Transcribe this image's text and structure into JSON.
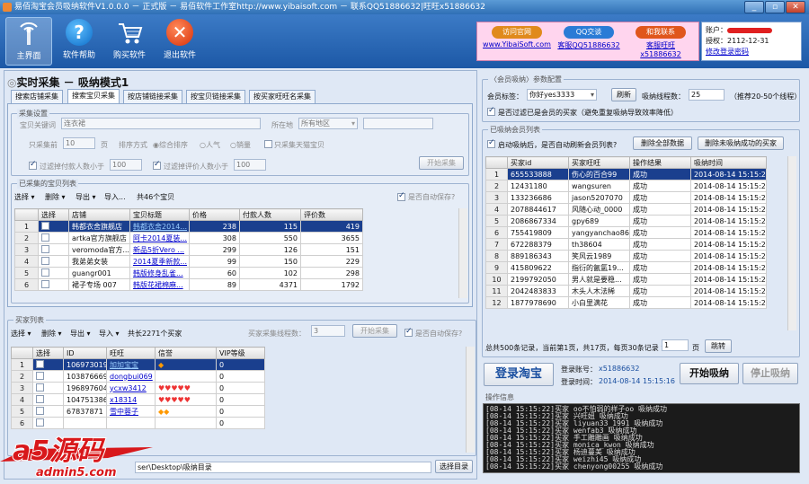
{
  "title": "易佰淘宝会员吸纳软件V1.0.0.0 － 正式版 － 易佰软件工作室http://www.yibaisoft.com － 联系QQ51886632|旺旺x51886632",
  "window_buttons": [
    "_",
    "▫",
    "✕"
  ],
  "toolbar": [
    {
      "label": "主界面"
    },
    {
      "label": "软件帮助"
    },
    {
      "label": "购买软件"
    },
    {
      "label": "退出软件"
    }
  ],
  "ads": [
    {
      "brand": "访问官网",
      "link": "www.YibaiSoft.com",
      "color": "#e08a1c"
    },
    {
      "brand": "QQ交谈",
      "link": "客服QQ51886632",
      "color": "#2a7bd6"
    },
    {
      "brand": "和我联系",
      "link": "客服旺旺x51886632",
      "color": "#e0561c"
    }
  ],
  "account": {
    "label": "账户：",
    "name": "",
    "expiry_label": "授权：",
    "expiry": "2112-12-31",
    "change_pwd": "修改登录密码"
  },
  "mode_title": "实时采集 － 吸纳模式1",
  "tabs": [
    "搜索店铺采集",
    "搜索宝贝采集",
    "按店铺链接采集",
    "按宝贝链接采集",
    "按买家旺旺名采集"
  ],
  "collect_settings": {
    "legend": "采集设置",
    "keyword_label": "宝贝关键词",
    "keyword": "连衣裙",
    "location_label": "所在地",
    "location": "所有地区",
    "pages_label": "只采集前",
    "pages": "10",
    "pages_unit": "页",
    "sort_label": "排序方式",
    "sort_options": [
      "综合排序",
      "人气",
      "销量"
    ],
    "tmall_only": "只采集天猫宝贝",
    "filter_payers": "过滤掉付款人数小于",
    "filter_payers_val": "100",
    "filter_reviews": "过滤掉评价人数小于",
    "filter_reviews_val": "100",
    "start_button": "开始采集"
  },
  "items_list": {
    "legend": "已采集的宝贝列表",
    "tools": [
      "选择 ▾",
      "删除 ▾",
      "导出 ▾",
      "导入..."
    ],
    "count": "共46个宝贝",
    "autosave": "是否自动保存?",
    "columns": [
      "选择",
      "店铺",
      "宝贝标题",
      "价格",
      "付款人数",
      "评价数"
    ],
    "rows": [
      {
        "n": "1",
        "shop": "韩都衣舍旗舰店",
        "title": "韩都衣舍2014...",
        "price": "238",
        "paid": "115",
        "reviews": "419"
      },
      {
        "n": "2",
        "shop": "artka官方旗舰店",
        "title": "阿卡2014夏装...",
        "price": "308",
        "paid": "550",
        "reviews": "3655"
      },
      {
        "n": "3",
        "shop": "veromoda官方...",
        "title": "新品5折Vero ...",
        "price": "299",
        "paid": "126",
        "reviews": "151"
      },
      {
        "n": "4",
        "shop": "我弟弟女装",
        "title": "2014夏季新款...",
        "price": "99",
        "paid": "150",
        "reviews": "229"
      },
      {
        "n": "5",
        "shop": "guangr001",
        "title": "韩版修身乱雀...",
        "price": "60",
        "paid": "102",
        "reviews": "298"
      },
      {
        "n": "6",
        "shop": "裙子专场 007",
        "title": "韩版花裙棉麻...",
        "price": "89",
        "paid": "4371",
        "reviews": "1792"
      }
    ]
  },
  "buyers_list": {
    "legend": "买家列表",
    "tools": [
      "选择 ▾",
      "删除 ▾",
      "导出 ▾",
      "导入 ▾"
    ],
    "count": "共长2271个买家",
    "threads_label": "买家采集线程数：",
    "threads": "3",
    "start_button": "开始采集",
    "autosave": "是否自动保存?",
    "columns": [
      "选择",
      "ID",
      "旺旺",
      "信誉",
      "VIP等级"
    ],
    "rows": [
      {
        "n": "1",
        "id": "1069730191",
        "ww": "加加宝宝",
        "rep": "◆",
        "vip": "0"
      },
      {
        "n": "2",
        "id": "103876669",
        "ww": "dongbui069",
        "rep": "",
        "vip": "0"
      },
      {
        "n": "3",
        "id": "196897604",
        "ww": "ycxw3412",
        "rep": "♥♥♥♥♥",
        "vip": "0"
      },
      {
        "n": "4",
        "id": "1047513869",
        "ww": "x18314",
        "rep": "♥♥♥♥♥",
        "vip": "0"
      },
      {
        "n": "5",
        "id": "67837871",
        "ww": "雪中蓉子",
        "rep": "◆◆",
        "vip": "0"
      },
      {
        "n": "6",
        "id": "",
        "ww": "",
        "rep": "",
        "vip": "0"
      }
    ]
  },
  "path": {
    "value": "ser\\Desktop\\吸纳目录",
    "button": "选择目录"
  },
  "member_config": {
    "legend": "〈会员吸纳〉参数配置",
    "tag_label": "会员标签：",
    "tag": "你好yes3333",
    "refresh": "刷新",
    "threads_label": "吸纳线程数：",
    "threads": "25",
    "threads_hint": "（推荐20-50个线程）",
    "filter": "是否过滤已是会员的买家（避免重复吸纳导致效率降低）"
  },
  "members": {
    "legend": "已吸纳会员列表",
    "auto_refresh": "启动吸纳后，是否自动刷新会员列表?",
    "delete_all": "删除全部数据",
    "delete_failed": "删除未吸纳成功的买家",
    "columns": [
      "买家id",
      "买家旺旺",
      "操作结果",
      "吸纳时间"
    ],
    "rows": [
      {
        "n": "1",
        "id": "655533888",
        "ww": "伤心的百合99",
        "res": "成功",
        "time": "2014-08-14 15:15:29"
      },
      {
        "n": "2",
        "id": "12431180",
        "ww": "wangsuren",
        "res": "成功",
        "time": "2014-08-14 15:15:28"
      },
      {
        "n": "3",
        "id": "133236686",
        "ww": "jason5207070",
        "res": "成功",
        "time": "2014-08-14 15:15:28"
      },
      {
        "n": "4",
        "id": "2078844617",
        "ww": "风随心动_0000",
        "res": "成功",
        "time": "2014-08-14 15:15:28"
      },
      {
        "n": "5",
        "id": "2086867334",
        "ww": "gpy689",
        "res": "成功",
        "time": "2014-08-14 15:15:28"
      },
      {
        "n": "6",
        "id": "755419809",
        "ww": "yangyanchao86",
        "res": "成功",
        "time": "2014-08-14 15:15:28"
      },
      {
        "n": "7",
        "id": "672288379",
        "ww": "th38604",
        "res": "成功",
        "time": "2014-08-14 15:15:28"
      },
      {
        "n": "8",
        "id": "889186343",
        "ww": "笑风云1989",
        "res": "成功",
        "time": "2014-08-14 15:15:28"
      },
      {
        "n": "9",
        "id": "415809622",
        "ww": "指衍的氤氲19...",
        "res": "成功",
        "time": "2014-08-14 15:15:28"
      },
      {
        "n": "10",
        "id": "2199792050",
        "ww": "男人就是要稳...",
        "res": "成功",
        "time": "2014-08-14 15:15:28"
      },
      {
        "n": "11",
        "id": "2042483833",
        "ww": "木头人木法稀",
        "res": "成功",
        "time": "2014-08-14 15:15:28"
      },
      {
        "n": "12",
        "id": "1877978690",
        "ww": "小白里满花",
        "res": "成功",
        "time": "2014-08-14 15:15:28"
      }
    ],
    "pager": "总共500条记录，当前第1页，共17页，每页30条记录 第",
    "page": "1",
    "page_unit": "页",
    "go": "跳转"
  },
  "login": {
    "button": "登录淘宝",
    "account_label": "登录账号：",
    "account": "x51886632",
    "time_label": "登录时间：",
    "time": "2014-08-14 15:15:16",
    "start": "开始吸纳",
    "stop": "停止吸纳"
  },
  "oplog": {
    "legend": "操作信息",
    "lines": [
      "[08-14 15:15:22]买家 oo不怕弱的样子oo 吸纳成功",
      "[08-14 15:15:22]买家 兴旺妞 吸纳成功",
      "[08-14 15:15:22]买家 liyuan33_1991 吸纳成功",
      "[08-14 15:15:22]买家 wenfab3 吸纳成功",
      "[08-14 15:15:22]买家 手工雕雕画 吸纳成功",
      "[08-14 15:15:22]买家 monica_kwon 吸纳成功",
      "[08-14 15:15:22]买家 杨迪蔓美 吸纳成功",
      "[08-14 15:15:22]买家 weizhi45 吸纳成功",
      "[08-14 15:15:22]买家 chenyong00255 吸纳成功"
    ]
  },
  "watermark": {
    "brand": "a5源码",
    "url": "admin5.com"
  },
  "colors": {
    "toolbar": "#1c58a6",
    "selected_row": "#1a3f8e",
    "login_text": "#1a4fa0"
  }
}
